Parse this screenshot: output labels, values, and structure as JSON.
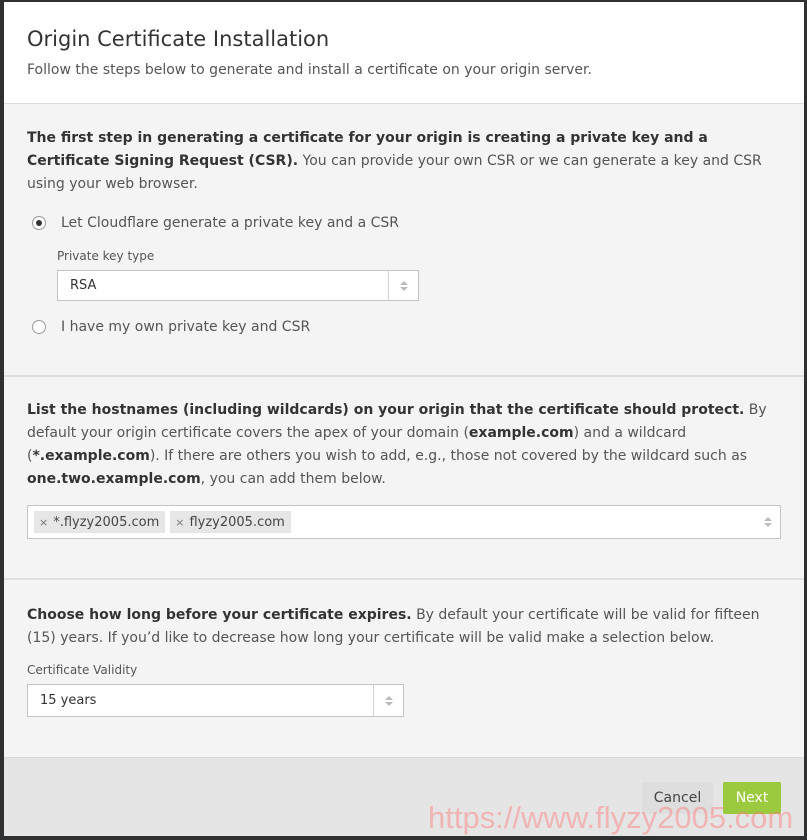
{
  "modal": {
    "title": "Origin Certificate Installation",
    "subtitle": "Follow the steps below to generate and install a certificate on your origin server."
  },
  "csr_section": {
    "intro_bold": "The first step in generating a certificate for your origin is creating a private key and a Certificate Signing Request (CSR).",
    "intro_text": " You can provide your own CSR or we can generate a key and CSR using your web browser.",
    "options": [
      {
        "label": "Let Cloudflare generate a private key and a CSR",
        "selected": true
      },
      {
        "label": "I have my own private key and CSR",
        "selected": false
      }
    ],
    "key_type_label": "Private key type",
    "key_type_value": "RSA"
  },
  "hostnames_section": {
    "intro_bold": "List the hostnames (including wildcards) on your origin that the certificate should protect.",
    "text1": " By default your origin certificate covers the apex of your domain (",
    "bold1": "example.com",
    "text2": ") and a wildcard (",
    "bold2": "*.example.com",
    "text3": "). If there are others you wish to add, e.g., those not covered by the wildcard such as ",
    "bold3": "one.two.example.com",
    "text4": ", you can add them below.",
    "tags": [
      "*.flyzy2005.com",
      "flyzy2005.com"
    ],
    "remove_glyph": "×"
  },
  "validity_section": {
    "intro_bold": "Choose how long before your certificate expires.",
    "intro_text": " By default your certificate will be valid for fifteen (15) years. If you’d like to decrease how long your certificate will be valid make a selection below.",
    "validity_label": "Certificate Validity",
    "validity_value": "15 years"
  },
  "footer": {
    "cancel_label": "Cancel",
    "next_label": "Next"
  },
  "colors": {
    "next_button": "#9bca3e",
    "cancel_button": "#dedede"
  },
  "watermark": "https://www.flyzy2005.com"
}
